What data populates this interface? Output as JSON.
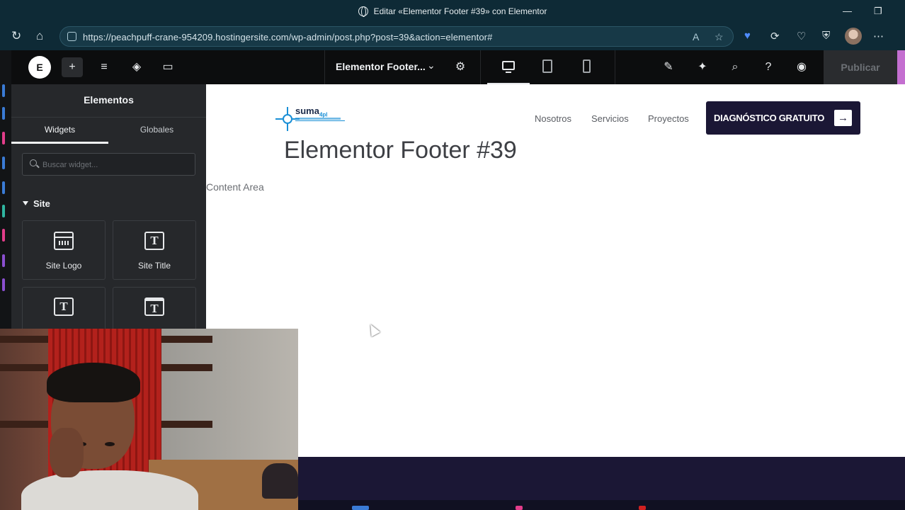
{
  "browser": {
    "window_title": "Editar «Elementor Footer #39» con Elementor",
    "url": "https://peachpuff-crane-954209.hostingersite.com/wp-admin/post.php?post=39&action=elementor#",
    "controls": {
      "minimize": "—",
      "restore": "❐"
    },
    "nav": {
      "reload": "↻",
      "home": "⌂"
    },
    "url_icons": {
      "read_aloud": "A",
      "favorite": "☆"
    },
    "extensions": [
      "♥",
      "⟳",
      "♡",
      "⛨",
      "⋯"
    ]
  },
  "editor": {
    "logo_glyph": "E",
    "toolbar": {
      "add": "+",
      "site_settings": "≡",
      "structure": "◈",
      "notes": "▭"
    },
    "document_name": "Elementor Footer...",
    "document_chevron": "⌄",
    "doc_settings": "⚙",
    "right_tools": {
      "apps": "✎",
      "whats_new": "✦",
      "finder": "⌕",
      "help": "?",
      "preview": "◉"
    },
    "publish_label": "Publicar",
    "collapse_glyph": "‹"
  },
  "panel": {
    "title": "Elementos",
    "tabs": [
      {
        "label": "Widgets",
        "selected": true
      },
      {
        "label": "Globales",
        "selected": false
      }
    ],
    "search_placeholder": "Buscar widget...",
    "category": "Site",
    "widgets": [
      {
        "label": "Site Logo",
        "icon": "site-logo-icon"
      },
      {
        "label": "Site Title",
        "icon": "site-title-icon",
        "glyph": "T"
      },
      {
        "label": "",
        "icon": "page-title-icon",
        "glyph": "T"
      },
      {
        "label": "",
        "icon": "nav-menu-icon",
        "glyph": "T"
      }
    ]
  },
  "canvas": {
    "brand_name": "suma",
    "brand_suffix": "4pl",
    "nav": [
      "Nosotros",
      "Servicios",
      "Proyectos"
    ],
    "cta_label": "DIAGNÓSTICO GRATUITO",
    "cta_arrow": "→",
    "page_title": "Elementor Footer #39",
    "content_area": "Content Area"
  },
  "colors": {
    "cta_bg": "#1b1735",
    "editor_bar": "#0c0d0e",
    "panel_bg": "#26282b",
    "brand_blue": "#1a8fd6"
  }
}
